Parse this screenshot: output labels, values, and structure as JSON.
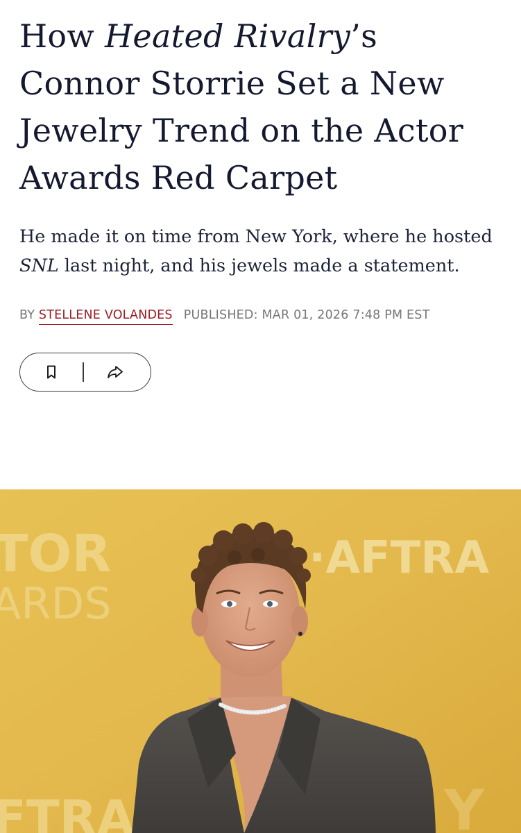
{
  "article": {
    "headline_pre": "How ",
    "headline_italic": "Heated Rivalry",
    "headline_post": "’s Connor Storrie Set a New Jewelry Trend on the Actor Awards Red Carpet",
    "dek_pre": "He made it on time from New York, where he hosted ",
    "dek_italic": "SNL",
    "dek_post": " last night, and his jewels made a statement.",
    "byline_prefix": "BY ",
    "author": "STELLENE VOLANDES",
    "published": "PUBLISHED: MAR 01, 2026 7:48 PM EST"
  },
  "actions": {
    "bookmark_icon": "bookmark-icon",
    "share_icon": "share-icon"
  },
  "hero": {
    "backdrop_text_left_1": "TOR",
    "backdrop_text_left_2": "ARDS",
    "backdrop_text_right": "·AFTRA",
    "backdrop_text_bottom_left": "FTRA",
    "backdrop_text_bottom_right": "Y",
    "colors": {
      "background": "#e3b84c",
      "jacket": "#4a4744",
      "hair": "#5a3a22",
      "skin": "#d99f80"
    }
  },
  "colors": {
    "headline": "#14192f",
    "author_link": "#9b1c24",
    "meta": "#767676"
  }
}
